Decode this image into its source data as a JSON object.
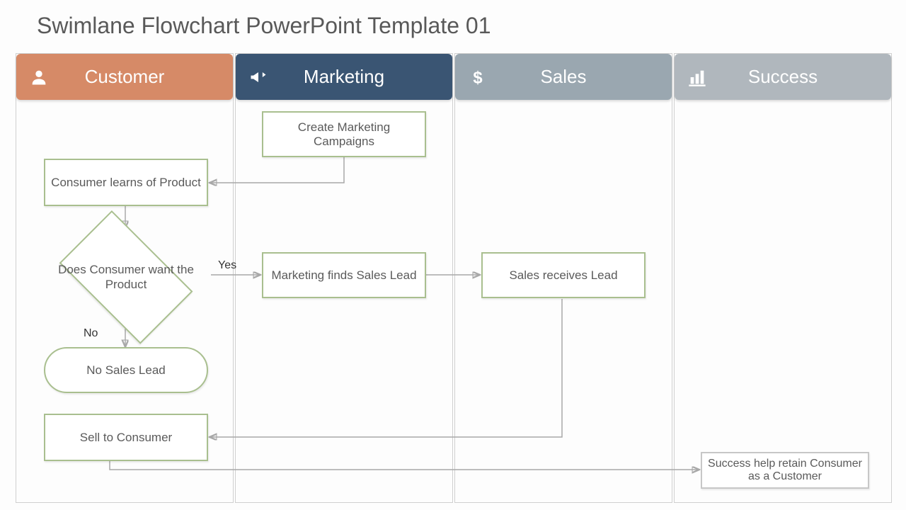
{
  "title": "Swimlane Flowchart PowerPoint Template 01",
  "lanes": {
    "customer": {
      "label": "Customer",
      "color": "#d68a67",
      "icon": "person-icon"
    },
    "marketing": {
      "label": "Marketing",
      "color": "#3a5573",
      "icon": "megaphone-icon"
    },
    "sales": {
      "label": "Sales",
      "color": "#9aa7b0",
      "icon": "dollar-icon"
    },
    "success": {
      "label": "Success",
      "color": "#b0b7bd",
      "icon": "bar-chart-icon"
    }
  },
  "nodes": {
    "create_campaigns": {
      "lane": "marketing",
      "type": "process",
      "label": "Create Marketing Campaigns"
    },
    "learns_product": {
      "lane": "customer",
      "type": "process",
      "label": "Consumer learns of Product"
    },
    "want_product": {
      "lane": "customer",
      "type": "decision",
      "label": "Does Consumer want the Product"
    },
    "finds_lead": {
      "lane": "marketing",
      "type": "process",
      "label": "Marketing finds Sales Lead"
    },
    "receives_lead": {
      "lane": "sales",
      "type": "process",
      "label": "Sales receives Lead"
    },
    "no_lead": {
      "lane": "customer",
      "type": "terminator",
      "label": "No Sales Lead"
    },
    "sell_consumer": {
      "lane": "customer",
      "type": "process",
      "label": "Sell to Consumer"
    },
    "retain_customer": {
      "lane": "success",
      "type": "process",
      "label": "Success help retain Consumer as a Customer"
    }
  },
  "edges": [
    {
      "from": "create_campaigns",
      "to": "learns_product"
    },
    {
      "from": "learns_product",
      "to": "want_product"
    },
    {
      "from": "want_product",
      "to": "finds_lead",
      "label": "Yes"
    },
    {
      "from": "want_product",
      "to": "no_lead",
      "label": "No"
    },
    {
      "from": "finds_lead",
      "to": "receives_lead"
    },
    {
      "from": "receives_lead",
      "to": "sell_consumer"
    },
    {
      "from": "sell_consumer",
      "to": "retain_customer"
    }
  ],
  "edge_labels": {
    "yes": "Yes",
    "no": "No"
  }
}
